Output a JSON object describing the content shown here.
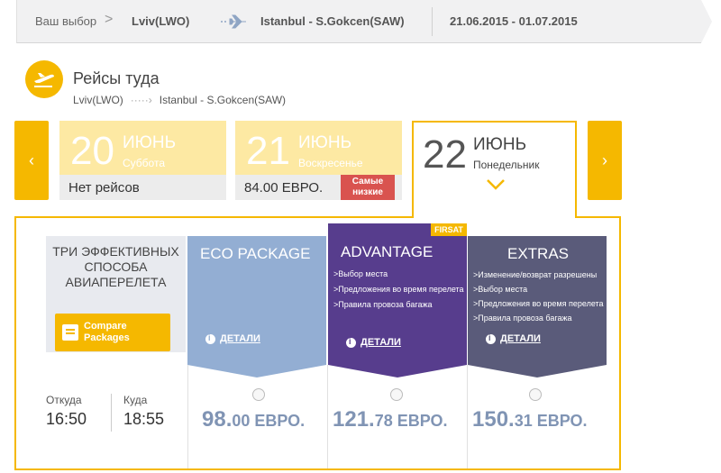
{
  "breadcrumb": {
    "choice_label": "Ваш выбор",
    "separator": ">",
    "from": "Lviv(LWO)",
    "to": "Istanbul - S.Gokcen(SAW)",
    "dates": "21.06.2015 - 01.07.2015"
  },
  "section": {
    "title": "Рейсы туда",
    "route_from": "Lviv(LWO)",
    "route_arrow": "·····›",
    "route_to": "Istanbul - S.Gokcen(SAW)"
  },
  "date_nav": {
    "prev_label": "‹",
    "next_label": "›",
    "days": [
      {
        "day": "20",
        "month": "ИЮНЬ",
        "weekday": "Суббота",
        "status": "Нет рейсов"
      },
      {
        "day": "21",
        "month": "ИЮНЬ",
        "weekday": "Воскресенье",
        "price": "84.00 ЕВРО.",
        "badge": "Самые низкие"
      },
      {
        "day": "22",
        "month": "ИЮНЬ",
        "weekday": "Понедельник"
      }
    ]
  },
  "packages_intro": {
    "title": "ТРИ ЭФФЕКТИВНЫХ СПОСОБА АВИАПЕРЕЛЕТА",
    "compare_line1": "Compare",
    "compare_line2": "Packages"
  },
  "packages": [
    {
      "name": "ECO PACKAGE",
      "features": [],
      "details": "ДЕТАЛИ",
      "price_int": "98.",
      "price_rest": "00 ЕВРО."
    },
    {
      "name": "ADVANTAGE",
      "badge": "FIRSAT",
      "features": [
        ">Выбор места",
        ">Предложения во время перелета",
        ">Правила провоза багажа"
      ],
      "details": "ДЕТАЛИ",
      "price_int": "121.",
      "price_rest": "78 ЕВРО."
    },
    {
      "name": "EXTRAS",
      "features": [
        ">Изменение/возврат разрешены",
        ">Выбор места",
        ">Предложения во время перелета",
        ">Правила провоза багажа"
      ],
      "details": "ДЕТАЛИ",
      "price_int": "150.",
      "price_rest": "31 ЕВРО."
    }
  ],
  "flight": {
    "depart_label": "Откуда",
    "depart_time": "16:50",
    "arrive_label": "Куда",
    "arrive_time": "18:55"
  },
  "colors": {
    "accent": "#f5b800",
    "eco": "#93aed3",
    "advantage": "#573d8d",
    "extras": "#5a5b7a",
    "lowest_badge": "#d9534f"
  }
}
